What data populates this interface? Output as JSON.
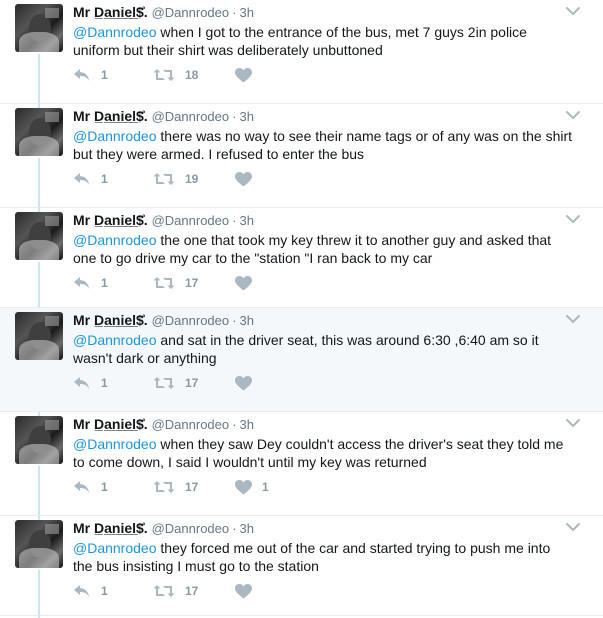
{
  "tweets": [
    {
      "name": "Mr D̲a̲n̲i̲e̲l̲$̊.",
      "handle": "@Dannrodeo",
      "separator": "·",
      "time": "3h",
      "mention": "@Dannrodeo",
      "body": " when I got to the entrance of the bus, met 7 guys 2in police uniform but their shirt was deliberately unbuttoned",
      "replies": "1",
      "retweets": "18",
      "likes": "",
      "highlighted": false
    },
    {
      "name": "Mr D̲a̲n̲i̲e̲l̲$̊.",
      "handle": "@Dannrodeo",
      "separator": "·",
      "time": "3h",
      "mention": "@Dannrodeo",
      "body": " there was no way to see their name tags or of any was on the shirt but they were armed. I refused to enter the bus",
      "replies": "1",
      "retweets": "19",
      "likes": "",
      "highlighted": false
    },
    {
      "name": "Mr D̲a̲n̲i̲e̲l̲$̊.",
      "handle": "@Dannrodeo",
      "separator": "·",
      "time": "3h",
      "mention": "@Dannrodeo",
      "body": " the one that took my key threw it to another guy and asked that one to go drive my car to the \"station \"I ran back to my car",
      "replies": "1",
      "retweets": "17",
      "likes": "",
      "highlighted": false
    },
    {
      "name": "Mr D̲a̲n̲i̲e̲l̲$̊.",
      "handle": "@Dannrodeo",
      "separator": "·",
      "time": "3h",
      "mention": "@Dannrodeo",
      "body": " and sat in the driver seat, this was around 6:30 ,6:40 am so it wasn't dark or anything",
      "replies": "1",
      "retweets": "17",
      "likes": "",
      "highlighted": true
    },
    {
      "name": "Mr D̲a̲n̲i̲e̲l̲$̊.",
      "handle": "@Dannrodeo",
      "separator": "·",
      "time": "3h",
      "mention": "@Dannrodeo",
      "body": " when they saw Dey couldn't access the driver's seat they told me to come down, I said I wouldn't until my key was returned",
      "replies": "1",
      "retweets": "17",
      "likes": "1",
      "highlighted": false
    },
    {
      "name": "Mr D̲a̲n̲i̲e̲l̲$̊.",
      "handle": "@Dannrodeo",
      "separator": "·",
      "time": "3h",
      "mention": "@Dannrodeo",
      "body": " they forced me out of the car and started trying to push me into the bus insisting I must go to the station",
      "replies": "1",
      "retweets": "17",
      "likes": "",
      "highlighted": false
    }
  ],
  "icons": {
    "reply": "reply-icon",
    "retweet": "retweet-icon",
    "like": "heart-icon",
    "menu": "chevron-down-icon"
  },
  "colors": {
    "mention": "#1b95e0",
    "icon": "#aab8c2",
    "thread_line": "#cce6f0",
    "highlight_bg": "#f5f8fa"
  }
}
